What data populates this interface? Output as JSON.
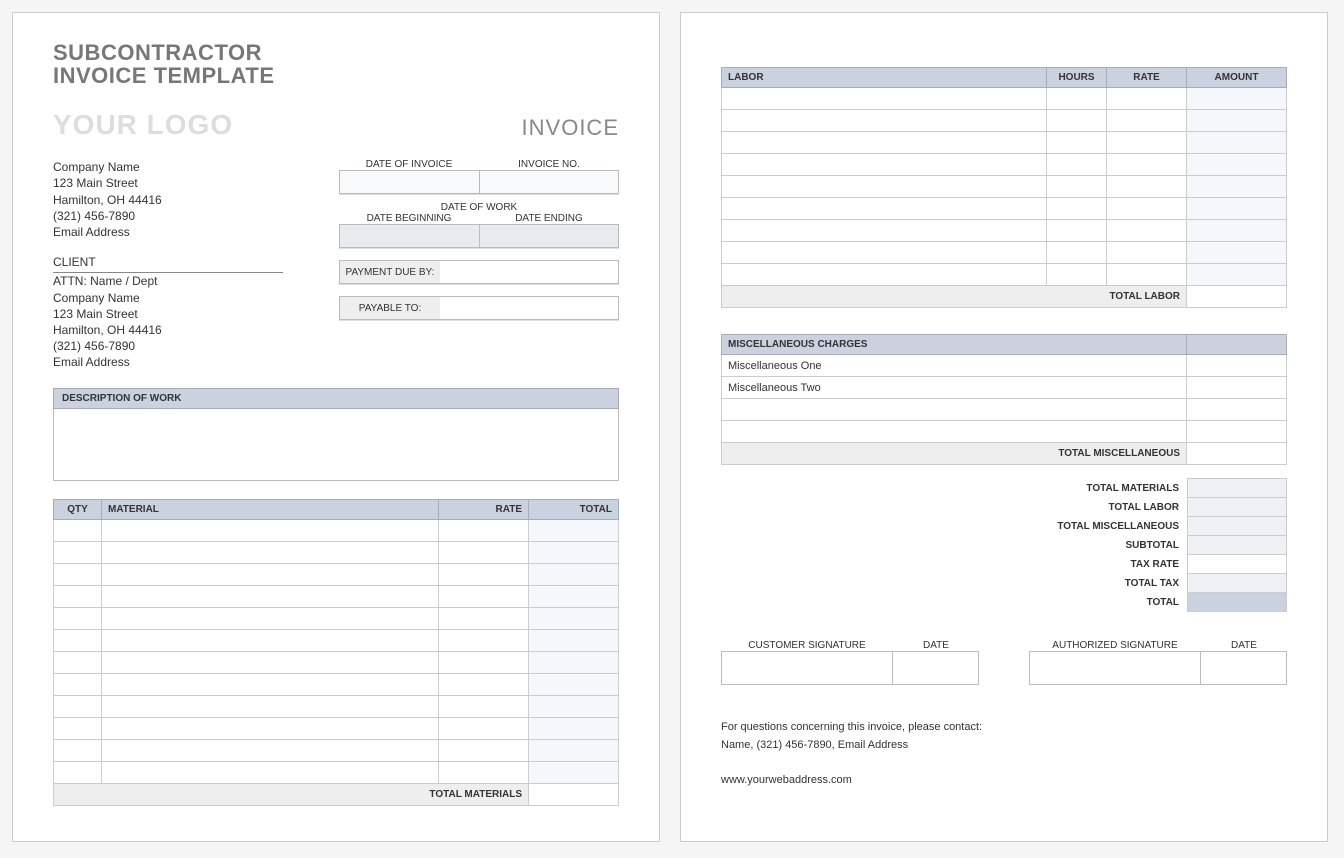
{
  "title_line1": "SUBCONTRACTOR",
  "title_line2": "INVOICE TEMPLATE",
  "logo_placeholder": "YOUR LOGO",
  "invoice_word": "INVOICE",
  "company": {
    "name": "Company Name",
    "street": "123 Main Street",
    "citystate": "Hamilton, OH  44416",
    "phone": "(321) 456-7890",
    "email": "Email Address"
  },
  "client_header": "CLIENT",
  "client": {
    "attn": "ATTN: Name / Dept",
    "name": "Company Name",
    "street": "123 Main Street",
    "citystate": "Hamilton, OH  44416",
    "phone": "(321) 456-7890",
    "email": "Email Address"
  },
  "meta": {
    "date_of_invoice_label": "DATE OF INVOICE",
    "invoice_no_label": "INVOICE NO.",
    "date_of_work_label": "DATE OF WORK",
    "date_beginning_label": "DATE BEGINNING",
    "date_ending_label": "DATE ENDING",
    "payment_due_label": "PAYMENT DUE BY:",
    "payable_to_label": "PAYABLE TO:"
  },
  "desc_header": "DESCRIPTION OF WORK",
  "materials": {
    "headers": {
      "qty": "QTY",
      "material": "MATERIAL",
      "rate": "RATE",
      "total": "TOTAL"
    },
    "row_count": 12,
    "total_label": "TOTAL MATERIALS"
  },
  "labor": {
    "headers": {
      "labor": "LABOR",
      "hours": "HOURS",
      "rate": "RATE",
      "amount": "AMOUNT"
    },
    "row_count": 9,
    "total_label": "TOTAL LABOR"
  },
  "misc": {
    "header": "MISCELLANEOUS CHARGES",
    "rows": [
      "Miscellaneous One",
      "Miscellaneous Two",
      "",
      ""
    ],
    "total_label": "TOTAL MISCELLANEOUS"
  },
  "totals": {
    "materials": "TOTAL MATERIALS",
    "labor": "TOTAL LABOR",
    "misc": "TOTAL MISCELLANEOUS",
    "subtotal": "SUBTOTAL",
    "taxrate": "TAX RATE",
    "totaltax": "TOTAL TAX",
    "total": "TOTAL"
  },
  "signatures": {
    "customer": "CUSTOMER SIGNATURE",
    "authorized": "AUTHORIZED SIGNATURE",
    "date": "DATE"
  },
  "footer": {
    "line1": "For questions concerning this invoice, please contact:",
    "line2": "Name, (321) 456-7890, Email Address",
    "web": "www.yourwebaddress.com"
  }
}
